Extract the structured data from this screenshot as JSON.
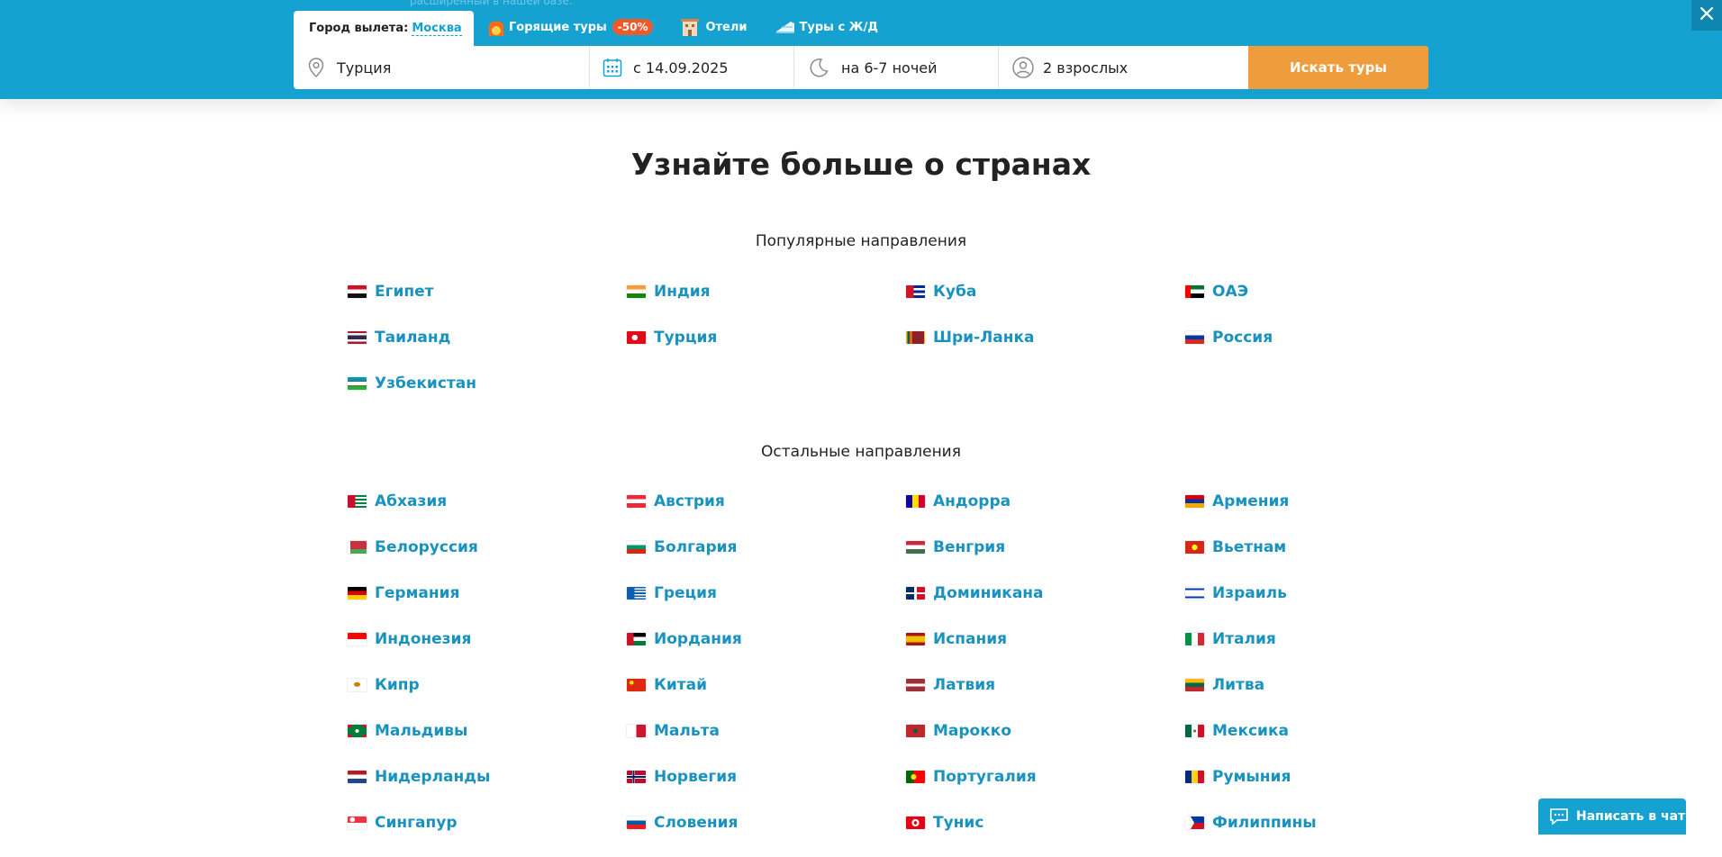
{
  "header": {
    "ghost_text": "расширенный в нашей базе.",
    "close_label": "×",
    "departure_label": "Город вылета:",
    "departure_city": "Москва",
    "links": [
      {
        "icon": "fire-icon",
        "label": "Горящие туры",
        "badge": "-50%"
      },
      {
        "icon": "hotel-icon",
        "label": "Отели"
      },
      {
        "icon": "train-icon",
        "label": "Туры с Ж/Д"
      }
    ]
  },
  "search": {
    "destination": "Турция",
    "date": "с 14.09.2025",
    "nights": "на 6-7 ночей",
    "guests": "2 взрослых",
    "button_label": "Искать туры"
  },
  "page_title": "Узнайте больше о странах",
  "popular": {
    "title": "Популярные направления",
    "items": [
      {
        "name": "Египет",
        "flag": "egypt"
      },
      {
        "name": "Индия",
        "flag": "india"
      },
      {
        "name": "Куба",
        "flag": "cuba"
      },
      {
        "name": "ОАЭ",
        "flag": "uae"
      },
      {
        "name": "Таиланд",
        "flag": "thailand"
      },
      {
        "name": "Турция",
        "flag": "turkey"
      },
      {
        "name": "Шри-Ланка",
        "flag": "srilanka"
      },
      {
        "name": "Россия",
        "flag": "russia"
      },
      {
        "name": "Узбекистан",
        "flag": "uzbekistan"
      }
    ]
  },
  "other": {
    "title": "Остальные направления",
    "items": [
      {
        "name": "Абхазия",
        "flag": "abkhazia"
      },
      {
        "name": "Австрия",
        "flag": "austria"
      },
      {
        "name": "Андорра",
        "flag": "andorra"
      },
      {
        "name": "Армения",
        "flag": "armenia"
      },
      {
        "name": "Белоруссия",
        "flag": "belarus"
      },
      {
        "name": "Болгария",
        "flag": "bulgaria"
      },
      {
        "name": "Венгрия",
        "flag": "hungary"
      },
      {
        "name": "Вьетнам",
        "flag": "vietnam"
      },
      {
        "name": "Германия",
        "flag": "germany"
      },
      {
        "name": "Греция",
        "flag": "greece"
      },
      {
        "name": "Доминикана",
        "flag": "dominicana"
      },
      {
        "name": "Израиль",
        "flag": "israel"
      },
      {
        "name": "Индонезия",
        "flag": "indonesia"
      },
      {
        "name": "Иордания",
        "flag": "jordan"
      },
      {
        "name": "Испания",
        "flag": "spain"
      },
      {
        "name": "Италия",
        "flag": "italy"
      },
      {
        "name": "Кипр",
        "flag": "cyprus"
      },
      {
        "name": "Китай",
        "flag": "china"
      },
      {
        "name": "Латвия",
        "flag": "latvia"
      },
      {
        "name": "Литва",
        "flag": "lithuania"
      },
      {
        "name": "Мальдивы",
        "flag": "maldives"
      },
      {
        "name": "Мальта",
        "flag": "malta"
      },
      {
        "name": "Марокко",
        "flag": "morocco"
      },
      {
        "name": "Мексика",
        "flag": "mexico"
      },
      {
        "name": "Нидерланды",
        "flag": "netherlands"
      },
      {
        "name": "Норвегия",
        "flag": "norway"
      },
      {
        "name": "Португалия",
        "flag": "portugal"
      },
      {
        "name": "Румыния",
        "flag": "romania"
      },
      {
        "name": "Сингапур",
        "flag": "singapore"
      },
      {
        "name": "Словения",
        "flag": "slovenia"
      },
      {
        "name": "Тунис",
        "flag": "tunisia"
      },
      {
        "name": "Филиппины",
        "flag": "philippines"
      }
    ]
  },
  "chat": {
    "label": "Написать в чат"
  },
  "colors": {
    "brand_blue": "#15a2d1",
    "link_blue": "#1a92bf",
    "search_orange": "#ef9c3c",
    "badge_red": "#ef5a2a"
  }
}
